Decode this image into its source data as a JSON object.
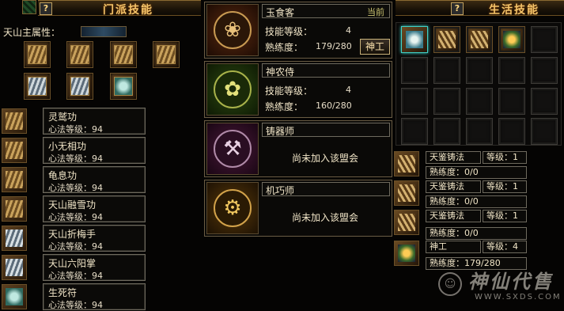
{
  "sect_panel": {
    "title": "门派技能",
    "help_label": "?",
    "attribute_label": "天山主属性：",
    "skill_icons": [
      "scroll-icon",
      "scroll-icon",
      "scroll-icon",
      "book-icon",
      "scroll-icon",
      "scroll-icon",
      "orb-icon"
    ],
    "skills": [
      {
        "name": "灵鹫功",
        "level": "心法等级：94"
      },
      {
        "name": "小无相功",
        "level": "心法等级：94"
      },
      {
        "name": "龟息功",
        "level": "心法等级：94"
      },
      {
        "name": "天山融雪功",
        "level": "心法等级：94"
      },
      {
        "name": "天山折梅手",
        "level": "心法等级：94"
      },
      {
        "name": "天山六阳掌",
        "level": "心法等级：94"
      },
      {
        "name": "生死符",
        "level": "心法等级：94"
      }
    ]
  },
  "professions": [
    {
      "name": "玉食客",
      "current": "当前",
      "skill_level_label": "技能等级：",
      "skill_level": "4",
      "proficiency_label": "熟练度：",
      "proficiency": "179/280",
      "button": "神工"
    },
    {
      "name": "神农侍",
      "skill_level_label": "技能等级：",
      "skill_level": "4",
      "proficiency_label": "熟练度：",
      "proficiency": "160/280"
    },
    {
      "name": "铸器师",
      "status": "尚未加入该盟会"
    },
    {
      "name": "机巧师",
      "status": "尚未加入该盟会"
    }
  ],
  "life_panel": {
    "title": "生活技能",
    "help_label": "?",
    "rows": [
      {
        "name": "天鉴铸法",
        "level": "等级：1",
        "proficiency": "熟练度：0/0"
      },
      {
        "name": "天鉴铸法",
        "level": "等级：1",
        "proficiency": "熟练度：0/0"
      },
      {
        "name": "天鉴铸法",
        "level": "等级：1",
        "proficiency": "熟练度：0/0"
      },
      {
        "name": "神工",
        "level": "等级：4",
        "proficiency": "熟练度：179/280"
      }
    ]
  },
  "watermark": {
    "text": "神仙代售",
    "url": "WWW.SXDS.COM"
  },
  "colors": {
    "title_gold": "#f4c46a",
    "panel_border": "#6e6a5e",
    "current_tag": "#c9c270",
    "selected_teal": "#3fd2c8"
  }
}
